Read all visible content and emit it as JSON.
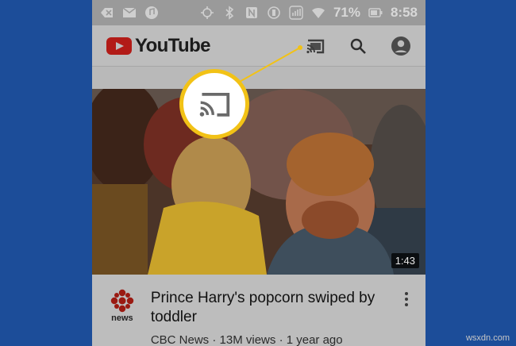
{
  "status_bar": {
    "battery_percent": "71%",
    "time": "8:58",
    "left_icons": [
      "back-icon",
      "mail-icon",
      "music-icon"
    ],
    "right_icons": [
      "location-icon",
      "bluetooth-icon",
      "nfc-icon",
      "vibrate-icon",
      "signal-icon",
      "wifi-icon",
      "battery-icon"
    ]
  },
  "app_bar": {
    "logo_text": "YouTube",
    "actions": [
      "cast-icon",
      "search-icon",
      "account-icon"
    ]
  },
  "video": {
    "duration": "1:43",
    "title": "Prince Harry's popcorn swiped by toddler",
    "channel": "CBC News",
    "views": "13M views",
    "age": "1 year ago",
    "separator": "·",
    "channel_logo_text": "news"
  },
  "callout": {
    "icon": "cast-icon",
    "accent": "#f2c216"
  },
  "watermark": "wsxdn.com",
  "colors": {
    "background": "#1c4d99",
    "youtube_red": "#b21b17"
  }
}
